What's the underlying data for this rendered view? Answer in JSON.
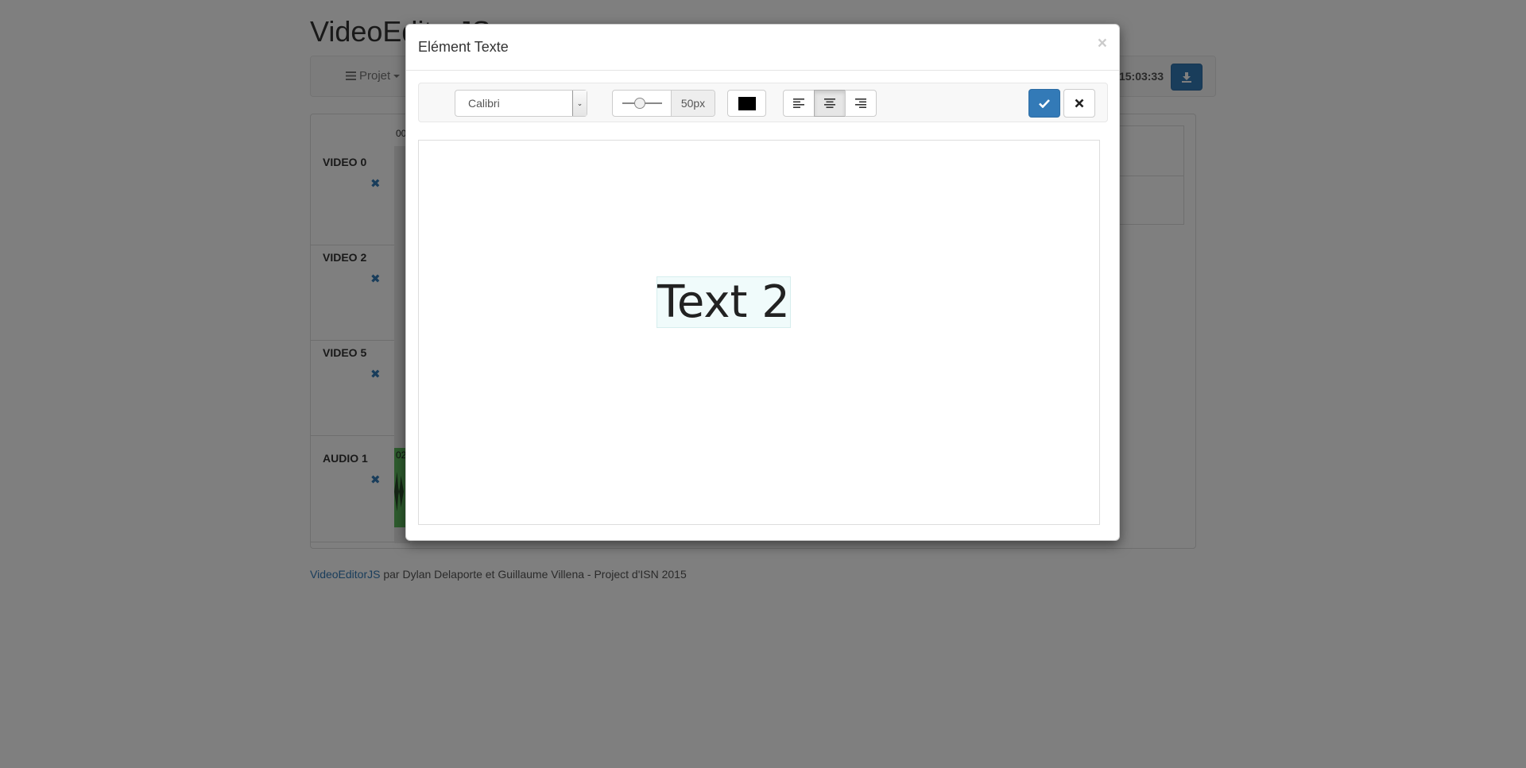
{
  "app": {
    "title": "VideoEditorJS"
  },
  "navbar": {
    "projet_label": "Projet",
    "time": "15:03:33"
  },
  "timeline": {
    "time_label": "00",
    "audio_time_label": "02",
    "tracks": [
      {
        "name": "VIDEO 0"
      },
      {
        "name": "VIDEO 2"
      },
      {
        "name": "VIDEO 5"
      },
      {
        "name": "AUDIO 1"
      }
    ]
  },
  "footer": {
    "link": "VideoEditorJS",
    "text": " par Dylan Delaporte et Guillaume Villena - Project d'ISN 2015"
  },
  "modal": {
    "title": "Elément Texte",
    "close_symbol": "×",
    "font_select": {
      "selected": "Calibri"
    },
    "font_size": {
      "value_label": "50px",
      "value": 50
    },
    "text_color": "#000000",
    "alignment": {
      "options": [
        "left",
        "center",
        "right"
      ],
      "selected": "center"
    },
    "text_element": {
      "text": "Text 2"
    }
  },
  "colors": {
    "primary": "#337ab7",
    "backdrop": "rgba(0,0,0,0.5)",
    "audio_clip": "#5cb85c"
  },
  "icons": {
    "projet": "list-icon",
    "download": "download-icon",
    "remove": "remove-icon",
    "confirm": "check-icon",
    "cancel": "close-icon",
    "align_left": "align-left-icon",
    "align_center": "align-center-icon",
    "align_right": "align-right-icon"
  }
}
